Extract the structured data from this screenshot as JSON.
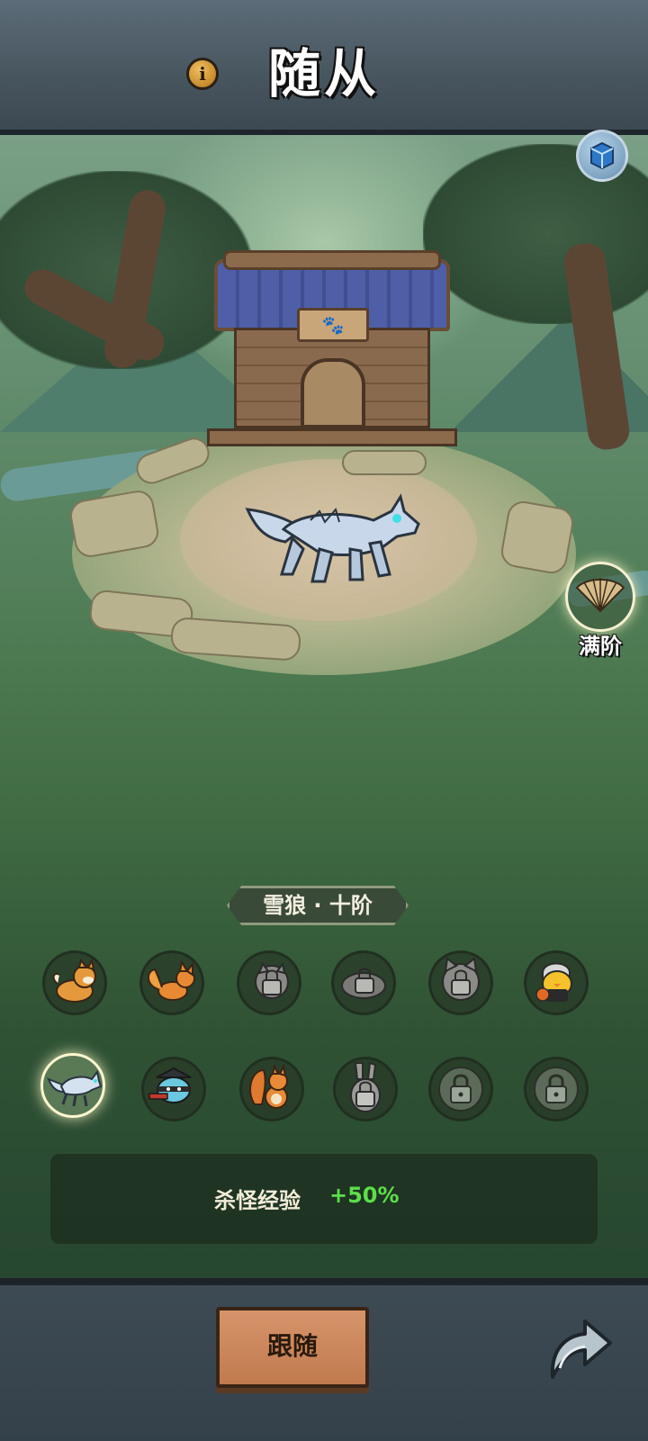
{
  "header": {
    "title": "随从",
    "info_icon": "info-icon"
  },
  "scene": {
    "kennel_sign_icon": "paw-print-icon",
    "current_companion_icon": "snow-wolf-icon",
    "cube_icon": "cube-icon"
  },
  "full_level": {
    "icon": "folding-fan-icon",
    "label": "满阶"
  },
  "companion": {
    "name": "雪狼 · 十阶"
  },
  "companions": [
    {
      "icon": "shiba-dog-icon",
      "locked": false,
      "selected": false
    },
    {
      "icon": "fox-icon",
      "locked": false,
      "selected": false
    },
    {
      "icon": "raccoon-locked-icon",
      "locked": true,
      "selected": false
    },
    {
      "icon": "mole-locked-icon",
      "locked": true,
      "selected": false
    },
    {
      "icon": "cat-locked-icon",
      "locked": true,
      "selected": false
    },
    {
      "icon": "basketball-chick-icon",
      "locked": false,
      "selected": false
    },
    {
      "icon": "snow-wolf-icon",
      "locked": false,
      "selected": true
    },
    {
      "icon": "ninja-panda-icon",
      "locked": false,
      "selected": false
    },
    {
      "icon": "squirrel-icon",
      "locked": false,
      "selected": false
    },
    {
      "icon": "rabbit-locked-icon",
      "locked": true,
      "selected": false
    },
    {
      "icon": "lock-icon",
      "locked": true,
      "selected": false
    },
    {
      "icon": "lock-icon",
      "locked": true,
      "selected": false
    }
  ],
  "bonus": {
    "label": "杀怪经验",
    "value": "+50%"
  },
  "footer": {
    "follow_label": "跟随",
    "share_icon": "share-arrow-icon"
  },
  "colors": {
    "bonus_value": "#5dde4a",
    "follow_button": "#c07a4e",
    "selected_glow": "#fff7d0"
  }
}
